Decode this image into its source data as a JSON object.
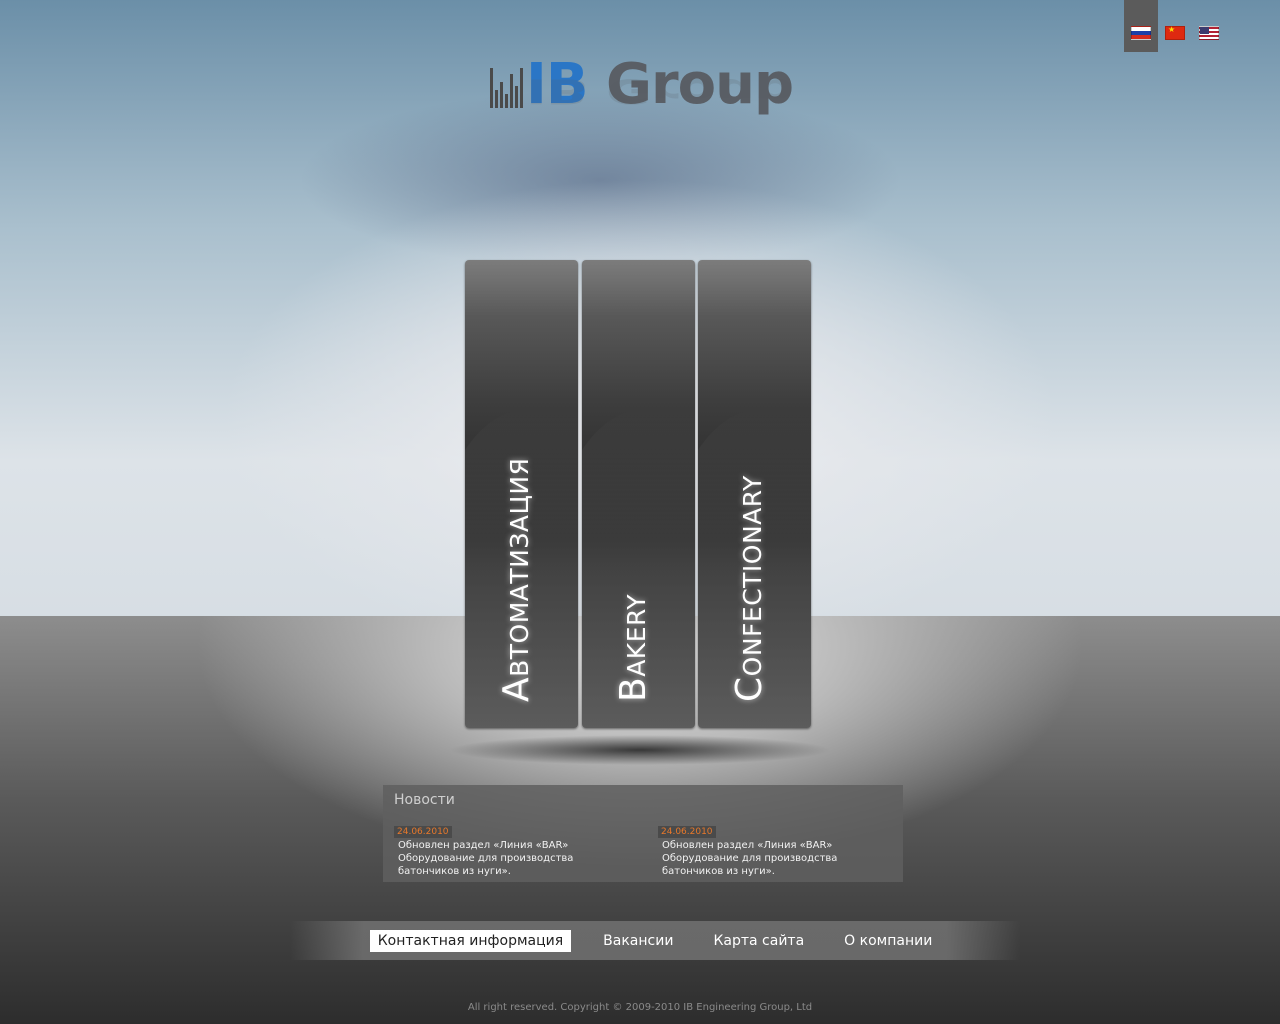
{
  "languages": [
    {
      "name": "russian-flag-icon",
      "active": true
    },
    {
      "name": "china-flag-icon",
      "active": false
    },
    {
      "name": "usa-flag-icon",
      "active": false
    }
  ],
  "logo": {
    "prefix": "IB",
    "suffix": " Group"
  },
  "panels": [
    {
      "label": "Автоматизация"
    },
    {
      "label": "Bakery"
    },
    {
      "label": "Confectionary"
    }
  ],
  "news": {
    "title": "Новости",
    "items": [
      {
        "date": "24.06.2010",
        "text": "Обновлен раздел «Линия «BAR» Оборудование для производства батончиков из нуги»."
      },
      {
        "date": "24.06.2010",
        "text": "Обновлен раздел «Линия «BAR» Оборудование для производства батончиков из нуги»."
      }
    ]
  },
  "menu": [
    {
      "label": "Контактная информация",
      "active": true
    },
    {
      "label": "Вакансии",
      "active": false
    },
    {
      "label": "Карта сайта",
      "active": false
    },
    {
      "label": "О компании",
      "active": false
    }
  ],
  "footer": {
    "copyright": "All right reserved. Copyright © 2009-2010 IB Engineering Group, Ltd"
  }
}
